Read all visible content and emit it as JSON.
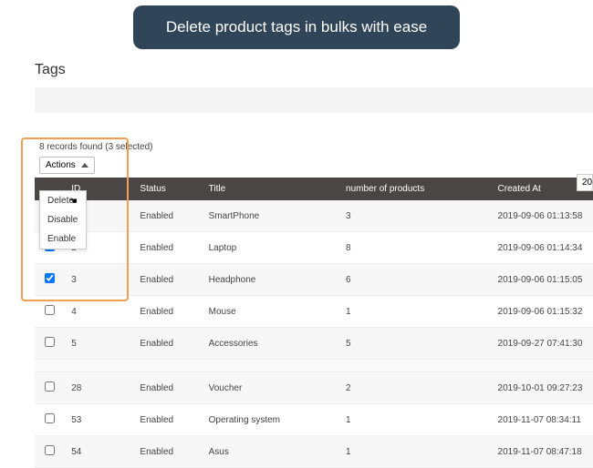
{
  "banner": {
    "text": "Delete product tags in bulks with ease"
  },
  "page": {
    "title": "Tags"
  },
  "records": {
    "summary": "8 records found (3 selected)"
  },
  "actions": {
    "label": "Actions",
    "menu": [
      "Delete",
      "Disable",
      "Enable"
    ]
  },
  "year_filter": "20",
  "columns": [
    "",
    "ID",
    "Status",
    "Title",
    "number of products",
    "Created At"
  ],
  "rows": [
    {
      "checked": true,
      "id": "",
      "status": "Enabled",
      "title": "SmartPhone",
      "num": "3",
      "created": "2019-09-06 01:13:58",
      "alt": true
    },
    {
      "checked": true,
      "id": "2",
      "status": "Enabled",
      "title": "Laptop",
      "num": "8",
      "created": "2019-09-06 01:14:34",
      "alt": false
    },
    {
      "checked": true,
      "id": "3",
      "status": "Enabled",
      "title": "Headphone",
      "num": "6",
      "created": "2019-09-06 01:15:05",
      "alt": true
    },
    {
      "checked": false,
      "id": "4",
      "status": "Enabled",
      "title": "Mouse",
      "num": "1",
      "created": "2019-09-06 01:15:32",
      "alt": false
    },
    {
      "checked": false,
      "id": "5",
      "status": "Enabled",
      "title": "Accessories",
      "num": "5",
      "created": "2019-09-27 07:41:30",
      "alt": true
    },
    {
      "checked": false,
      "id": "28",
      "status": "Enabled",
      "title": "Voucher",
      "num": "2",
      "created": "2019-10-01 09:27:23",
      "alt": true,
      "spacer_before": true
    },
    {
      "checked": false,
      "id": "53",
      "status": "Enabled",
      "title": "Operating system",
      "num": "1",
      "created": "2019-11-07 08:34:11",
      "alt": false
    },
    {
      "checked": false,
      "id": "54",
      "status": "Enabled",
      "title": "Asus",
      "num": "1",
      "created": "2019-11-07 08:47:18",
      "alt": true
    }
  ]
}
